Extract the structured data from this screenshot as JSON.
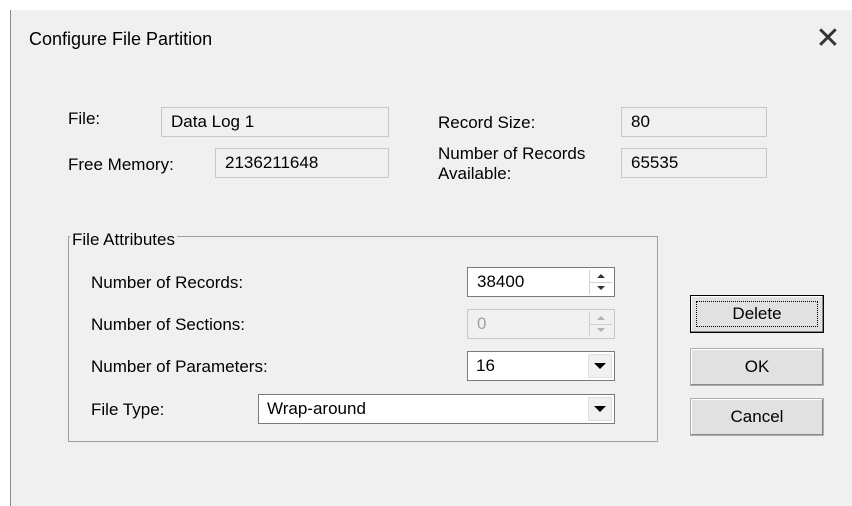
{
  "window": {
    "title": "Configure File Partition",
    "close_glyph": "✕"
  },
  "info": {
    "file_label": "File:",
    "file_value": "Data Log 1",
    "record_size_label": "Record Size:",
    "record_size_value": "80",
    "free_memory_label": "Free Memory:",
    "free_memory_value": "2136211648",
    "records_available_label_line1": "Number of Records",
    "records_available_label_line2": "Available:",
    "records_available_value": "65535"
  },
  "attributes": {
    "group_title": "File Attributes",
    "num_records_label": "Number of Records:",
    "num_records_value": "38400",
    "num_sections_label": "Number of Sections:",
    "num_sections_value": "0",
    "num_params_label": "Number of Parameters:",
    "num_params_value": "16",
    "file_type_label": "File Type:",
    "file_type_value": "Wrap-around"
  },
  "buttons": {
    "delete": "Delete",
    "ok": "OK",
    "cancel": "Cancel"
  },
  "icons": {
    "close": "close-icon",
    "spin_up": "spin-up-icon",
    "spin_down": "spin-down-icon",
    "dropdown": "dropdown-arrow-icon"
  }
}
